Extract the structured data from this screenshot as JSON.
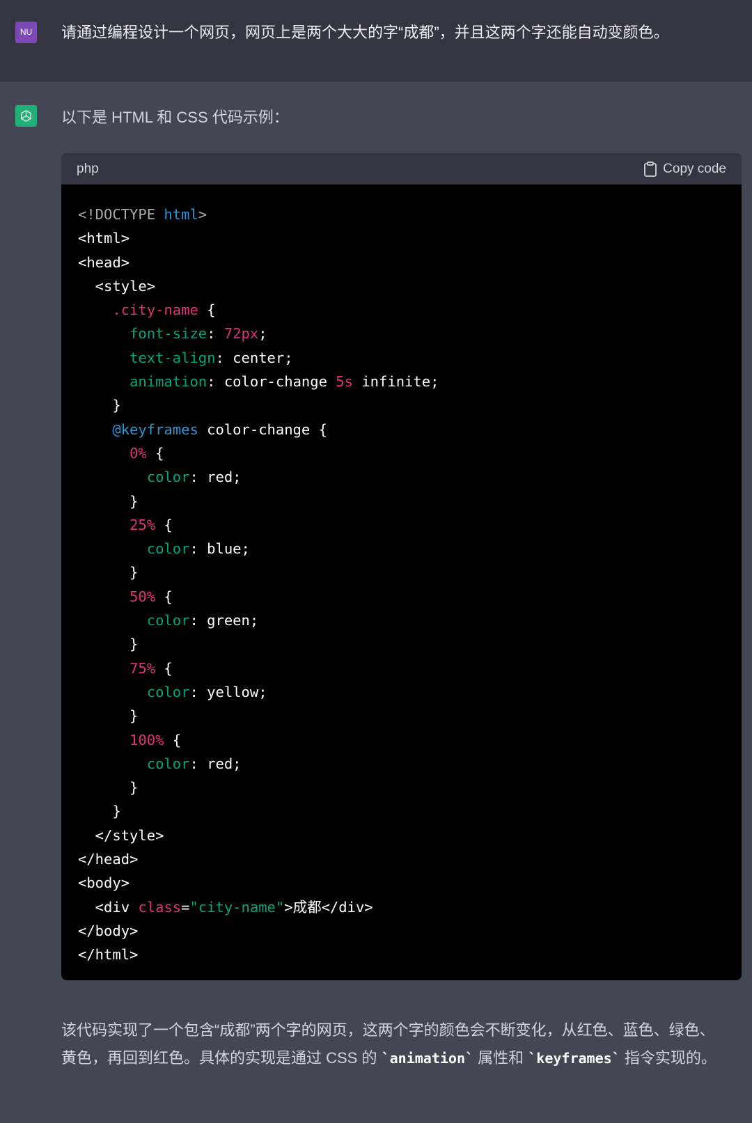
{
  "user_message": {
    "avatar_initials": "NU",
    "text": "请通过编程设计一个网页，网页上是两个大大的字“成都”，并且这两个字还能自动变颜色。"
  },
  "assistant_message": {
    "intro": "以下是 HTML 和 CSS 代码示例：",
    "code_block": {
      "language": "php",
      "copy_label": "Copy code",
      "lines": [
        [
          {
            "t": "<!DOCTYPE ",
            "c": "doc"
          },
          {
            "t": "html",
            "c": "blue"
          },
          {
            "t": ">",
            "c": "doc"
          }
        ],
        [
          {
            "t": "<html>",
            "c": "white"
          }
        ],
        [
          {
            "t": "<head>",
            "c": "white"
          }
        ],
        [
          {
            "t": "  <style>",
            "c": "white"
          }
        ],
        [
          {
            "t": "    .city-name",
            "c": "pink"
          },
          {
            "t": " {",
            "c": "white"
          }
        ],
        [
          {
            "t": "      ",
            "c": "white"
          },
          {
            "t": "font-size",
            "c": "green"
          },
          {
            "t": ": ",
            "c": "white"
          },
          {
            "t": "72px",
            "c": "pink"
          },
          {
            "t": ";",
            "c": "white"
          }
        ],
        [
          {
            "t": "      ",
            "c": "white"
          },
          {
            "t": "text-align",
            "c": "green"
          },
          {
            "t": ": center;",
            "c": "white"
          }
        ],
        [
          {
            "t": "      ",
            "c": "white"
          },
          {
            "t": "animation",
            "c": "green"
          },
          {
            "t": ": color-change ",
            "c": "white"
          },
          {
            "t": "5s",
            "c": "pink"
          },
          {
            "t": " infinite;",
            "c": "white"
          }
        ],
        [
          {
            "t": "    }",
            "c": "white"
          }
        ],
        [
          {
            "t": "    ",
            "c": "white"
          },
          {
            "t": "@keyframes",
            "c": "blue"
          },
          {
            "t": " color-change {",
            "c": "white"
          }
        ],
        [
          {
            "t": "      ",
            "c": "white"
          },
          {
            "t": "0%",
            "c": "pink"
          },
          {
            "t": " {",
            "c": "white"
          }
        ],
        [
          {
            "t": "        ",
            "c": "white"
          },
          {
            "t": "color",
            "c": "green"
          },
          {
            "t": ": red;",
            "c": "white"
          }
        ],
        [
          {
            "t": "      }",
            "c": "white"
          }
        ],
        [
          {
            "t": "      ",
            "c": "white"
          },
          {
            "t": "25%",
            "c": "pink"
          },
          {
            "t": " {",
            "c": "white"
          }
        ],
        [
          {
            "t": "        ",
            "c": "white"
          },
          {
            "t": "color",
            "c": "green"
          },
          {
            "t": ": blue;",
            "c": "white"
          }
        ],
        [
          {
            "t": "      }",
            "c": "white"
          }
        ],
        [
          {
            "t": "      ",
            "c": "white"
          },
          {
            "t": "50%",
            "c": "pink"
          },
          {
            "t": " {",
            "c": "white"
          }
        ],
        [
          {
            "t": "        ",
            "c": "white"
          },
          {
            "t": "color",
            "c": "green"
          },
          {
            "t": ": green;",
            "c": "white"
          }
        ],
        [
          {
            "t": "      }",
            "c": "white"
          }
        ],
        [
          {
            "t": "      ",
            "c": "white"
          },
          {
            "t": "75%",
            "c": "pink"
          },
          {
            "t": " {",
            "c": "white"
          }
        ],
        [
          {
            "t": "        ",
            "c": "white"
          },
          {
            "t": "color",
            "c": "green"
          },
          {
            "t": ": yellow;",
            "c": "white"
          }
        ],
        [
          {
            "t": "      }",
            "c": "white"
          }
        ],
        [
          {
            "t": "      ",
            "c": "white"
          },
          {
            "t": "100%",
            "c": "pink"
          },
          {
            "t": " {",
            "c": "white"
          }
        ],
        [
          {
            "t": "        ",
            "c": "white"
          },
          {
            "t": "color",
            "c": "green"
          },
          {
            "t": ": red;",
            "c": "white"
          }
        ],
        [
          {
            "t": "      }",
            "c": "white"
          }
        ],
        [
          {
            "t": "    }",
            "c": "white"
          }
        ],
        [
          {
            "t": "  </style>",
            "c": "white"
          }
        ],
        [
          {
            "t": "</head>",
            "c": "white"
          }
        ],
        [
          {
            "t": "<body>",
            "c": "white"
          }
        ],
        [
          {
            "t": "  <div ",
            "c": "white"
          },
          {
            "t": "class",
            "c": "pink"
          },
          {
            "t": "=",
            "c": "white"
          },
          {
            "t": "\"city-name\"",
            "c": "str"
          },
          {
            "t": ">成都</div>",
            "c": "white"
          }
        ],
        [
          {
            "t": "</body>",
            "c": "white"
          }
        ],
        [
          {
            "t": "</html>",
            "c": "white"
          }
        ]
      ]
    },
    "outro": {
      "part1": "该代码实现了一个包含“成都”两个字的网页，这两个字的颜色会不断变化，从红色、蓝色、绿色、黄色，再回到红色。具体的实现是通过 CSS 的 ",
      "code1": "`animation`",
      "part2": " 属性和 ",
      "code2": "`keyframes`",
      "part3": " 指令实现的。"
    }
  },
  "colors": {
    "page_bg": "#444654",
    "user_row_bg": "#343541",
    "code_bg": "#000000",
    "code_header_bg": "#343541",
    "user_avatar": "#7b48b4",
    "bot_avatar": "#19c37d"
  },
  "icons": {
    "bot_avatar": "openai-logo-icon",
    "copy": "clipboard-icon"
  }
}
